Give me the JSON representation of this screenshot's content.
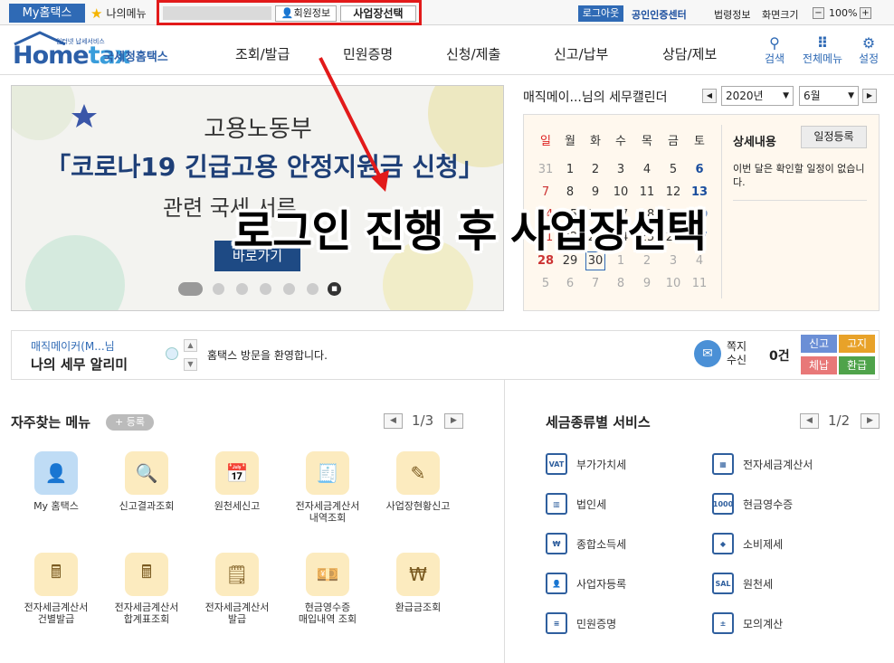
{
  "topbar": {
    "my_hometax": "My홈택스",
    "my_menu": "나의메뉴",
    "member_info": "회원정보",
    "business_select": "사업장선택",
    "logout": "로그아웃",
    "cert_center": "공인인증센터",
    "law_info": "법령정보",
    "screen_size": "화면크기",
    "zoom_minus": "−",
    "zoom": "100%",
    "zoom_plus": "+"
  },
  "header": {
    "logo_small": "인터넷 납세서비스",
    "logo_main_a": "Home",
    "logo_main_b": "tax",
    "logo_kr": "국세청홈택스",
    "nav": [
      "조회/발급",
      "민원증명",
      "신청/제출",
      "신고/납부",
      "상담/제보"
    ],
    "search_label": "검색",
    "all_menu_label": "전체메뉴",
    "settings_label": "설정"
  },
  "banner": {
    "line1": "고용노동부",
    "line2": "「코로나19 긴급고용 안정지원금 신청」",
    "line3": "관련 국세 서류",
    "button": "바로가기"
  },
  "overlay_caption": "로그인 진행 후 사업장선택",
  "calendar": {
    "title": "매직메이...님의 세무캘린더",
    "year": "2020년",
    "month": "6월",
    "weekdays": [
      "일",
      "월",
      "화",
      "수",
      "목",
      "금",
      "토"
    ],
    "weeks": [
      [
        "31",
        "1",
        "2",
        "3",
        "4",
        "5",
        "6"
      ],
      [
        "7",
        "8",
        "9",
        "10",
        "11",
        "12",
        "13"
      ],
      [
        "14",
        "15",
        "16",
        "17",
        "18",
        "19",
        "20"
      ],
      [
        "21",
        "22",
        "23",
        "24",
        "25",
        "26",
        "27"
      ],
      [
        "28",
        "29",
        "30",
        "1",
        "2",
        "3",
        "4"
      ],
      [
        "5",
        "6",
        "7",
        "8",
        "9",
        "10",
        "11"
      ]
    ],
    "detail_title": "상세내용",
    "register_button": "일정등록",
    "empty_message": "이번 달은 확인할 일정이 없습니다."
  },
  "notice": {
    "user": "매직메이커(M...님",
    "title": "나의 세무 알리미",
    "message": "홈택스 방문을 환영합니다.",
    "msg_label_1": "쪽지",
    "msg_label_2": "수신",
    "msg_count": "0건",
    "tags": [
      "신고",
      "고지",
      "체납",
      "환급"
    ]
  },
  "favorites": {
    "title": "자주찾는 메뉴",
    "register": "+ 등록",
    "page": "1/3",
    "items": [
      "My 홈택스",
      "신고결과조회",
      "원천세신고",
      "전자세금계산서\n내역조회",
      "사업장현황신고",
      "전자세금계산서\n건별발급",
      "전자세금계산서\n합계표조회",
      "전자세금계산서\n발급",
      "현금영수증\n매입내역 조회",
      "환급금조회"
    ]
  },
  "services": {
    "title": "세금종류별 서비스",
    "page": "1/2",
    "items": [
      "부가가치세",
      "전자세금계산서",
      "법인세",
      "현금영수증",
      "종합소득세",
      "소비제세",
      "사업자등록",
      "원천세",
      "민원증명",
      "모의계산"
    ]
  },
  "colors": {
    "primary": "#2f6ab5",
    "highlight": "#e21a1a",
    "tag_blue": "#6b8fd6",
    "tag_orange": "#e8a229",
    "tag_red": "#e87878",
    "tag_green": "#4fa34a"
  }
}
